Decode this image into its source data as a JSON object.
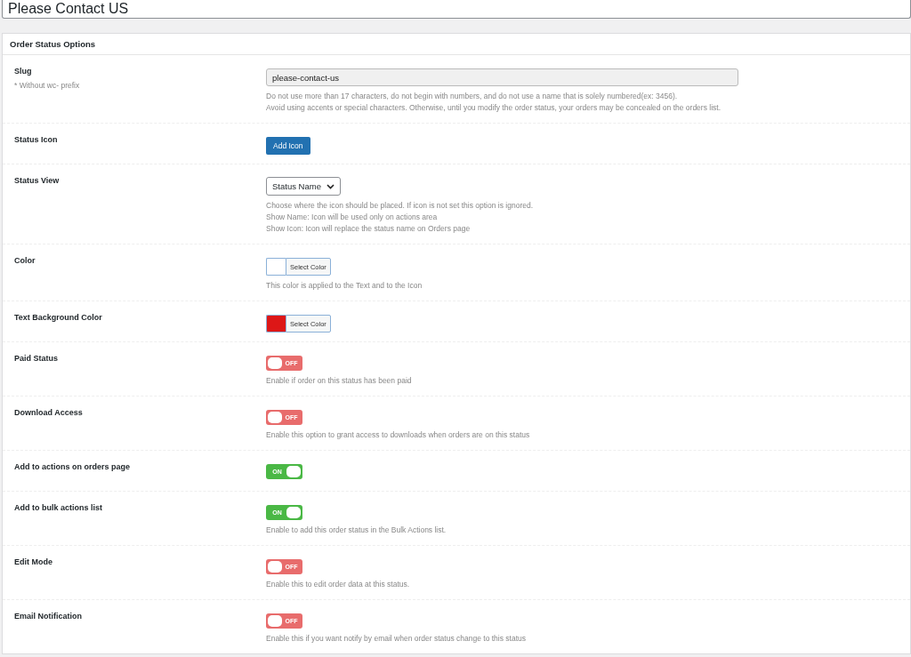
{
  "title_field": {
    "value": "Please Contact US"
  },
  "panel": {
    "title": "Order Status Options",
    "rows": [
      {
        "kind": "text",
        "label": "Slug",
        "note": "* Without wc- prefix",
        "value": "please-contact-us",
        "help": [
          "Do not use more than 17 characters, do not begin with numbers, and do not use a name that is solely numbered(ex: 3456).",
          "Avoid using accents or special characters. Otherwise, until you modify the order status, your orders may be concealed on the orders list."
        ]
      },
      {
        "kind": "button",
        "label": "Status Icon",
        "button": "Add Icon"
      },
      {
        "kind": "select",
        "label": "Status View",
        "value": "Status Name",
        "help": [
          "Choose where the icon should be placed. If icon is not set this option is ignored.",
          "Show Name: Icon will be used only on actions area",
          "Show Icon: Icon will replace the status name on Orders page"
        ]
      },
      {
        "kind": "color",
        "label": "Color",
        "button": "Select Color",
        "color": "#ffffff",
        "help": [
          "This color is applied to the Text and to the Icon"
        ]
      },
      {
        "kind": "color",
        "label": "Text Background Color",
        "button": "Select Color",
        "color": "#dd1717"
      },
      {
        "kind": "toggle",
        "label": "Paid Status",
        "on": false,
        "state_text": "OFF",
        "help": [
          "Enable if order on this status has been paid"
        ]
      },
      {
        "kind": "toggle",
        "label": "Download Access",
        "on": false,
        "state_text": "OFF",
        "help": [
          "Enable this option to grant access to downloads when orders are on this status"
        ]
      },
      {
        "kind": "toggle",
        "label": "Add to actions on orders page",
        "on": true,
        "state_text": "ON"
      },
      {
        "kind": "toggle",
        "label": "Add to bulk actions list",
        "on": true,
        "state_text": "ON",
        "help": [
          "Enable to add this order status in the Bulk Actions list."
        ]
      },
      {
        "kind": "toggle",
        "label": "Edit Mode",
        "on": false,
        "state_text": "OFF",
        "help": [
          "Enable this to edit order data at this status."
        ]
      },
      {
        "kind": "toggle",
        "label": "Email Notification",
        "on": false,
        "state_text": "OFF",
        "help": [
          "Enable this if you want notify by email when order status change to this status"
        ]
      }
    ]
  }
}
